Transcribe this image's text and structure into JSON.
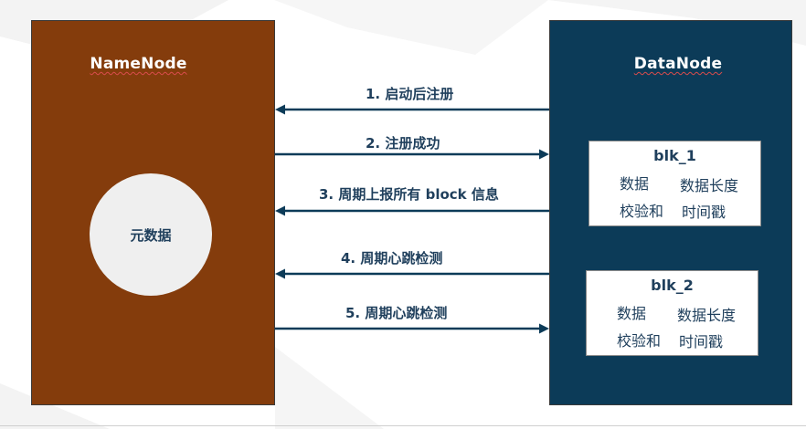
{
  "namenode": {
    "title": "NameNode",
    "metadata_label": "元数据"
  },
  "datanode": {
    "title": "DataNode",
    "blocks": [
      {
        "name": "blk_1",
        "fields": [
          "数据",
          "数据长度",
          "校验和",
          "时间戳"
        ]
      },
      {
        "name": "blk_2",
        "fields": [
          "数据",
          "数据长度",
          "校验和",
          "时间戳"
        ]
      }
    ]
  },
  "messages": [
    {
      "label": "1. 启动后注册",
      "direction": "DataNode→NameNode"
    },
    {
      "label": "2. 注册成功",
      "direction": "NameNode→DataNode"
    },
    {
      "label": "3. 周期上报所有 block 信息",
      "direction": "DataNode→NameNode"
    },
    {
      "label": "4. 周期心跳检测",
      "direction": "DataNode→NameNode"
    },
    {
      "label": "5. 周期心跳检测",
      "direction": "NameNode→DataNode"
    }
  ],
  "colors": {
    "namenode": "#843c0c",
    "datanode": "#0c3b58",
    "arrow": "#0c3b58",
    "text": "#1f3f5c"
  }
}
